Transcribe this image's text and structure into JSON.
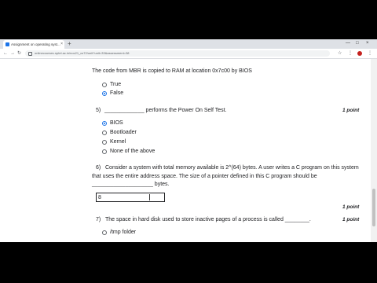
{
  "browser": {
    "tab_title": "Assignment on operating syst...",
    "tab_close": "×",
    "new_tab": "+",
    "window_minimize": "—",
    "window_maximize": "□",
    "window_close": "×",
    "url": "onlinecourses.nptel.ac.in/noc21_cs72/unit?unit=33&assessment=38",
    "nav_back": "←",
    "nav_forward": "→",
    "nav_reload": "↻",
    "star": "☆",
    "extensions": "⋮",
    "menu": "⋮"
  },
  "questions": [
    {
      "id": "q4",
      "text": "The code from MBR is copied to RAM at location 0x7c00 by BIOS",
      "options": [
        {
          "label": "True",
          "selected": false
        },
        {
          "label": "False",
          "selected": true
        }
      ]
    },
    {
      "id": "q5",
      "number": "5)",
      "text": "_____________ performs the Power On Self Test.",
      "points": "1 point",
      "options": [
        {
          "label": "BIOS",
          "selected": true
        },
        {
          "label": "Bootloader",
          "selected": false
        },
        {
          "label": "Kernel",
          "selected": false
        },
        {
          "label": "None of the above",
          "selected": false
        }
      ]
    },
    {
      "id": "q6",
      "number": "6)",
      "text_line1": "Consider a system with total memory available is 2^(64) bytes. A user writes a C program on this system",
      "text_line2": "that uses the entire address space. The size of a pointer defined in this C program should be",
      "text_line3": "____________________ bytes.",
      "answer": "8",
      "points": "1 point"
    },
    {
      "id": "q7",
      "number": "7)",
      "text": "The space in hard disk used to store inactive pages of a process is called ________.",
      "points": "1 point",
      "options": [
        {
          "label": "/tmp folder",
          "selected": false
        }
      ]
    }
  ]
}
